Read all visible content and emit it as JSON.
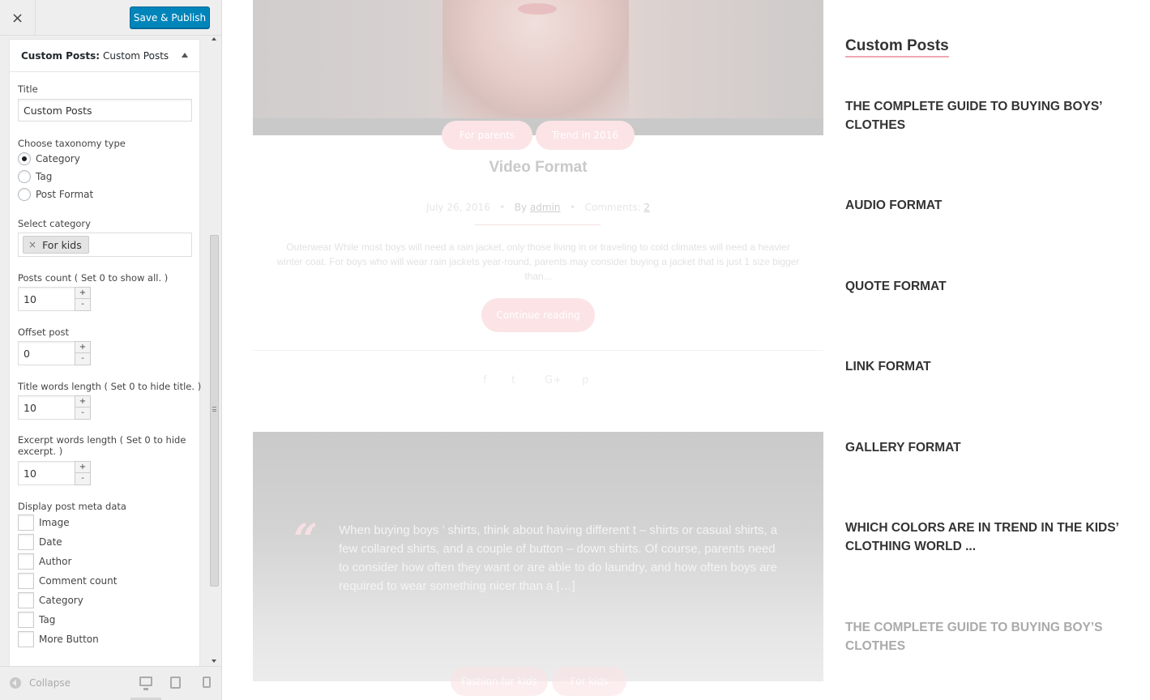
{
  "header": {
    "close_icon": "×",
    "publish_label": "Save & Publish"
  },
  "widget": {
    "title_prefix": "Custom Posts:",
    "title_name": "Custom Posts",
    "fields": {
      "title_label": "Title",
      "title_value": "Custom Posts",
      "taxonomy_label": "Choose taxonomy type",
      "taxonomy_options": [
        "Category",
        "Tag",
        "Post Format"
      ],
      "taxonomy_selected": "Category",
      "category_label": "Select category",
      "category_tag": "For kids",
      "category_tag_remove": "×",
      "posts_count_label": "Posts count ( Set 0 to show all. )",
      "posts_count_value": "10",
      "offset_label": "Offset post",
      "offset_value": "0",
      "title_words_label": "Title words length ( Set 0 to hide title. )",
      "title_words_value": "10",
      "excerpt_words_label": "Excerpt words length ( Set 0 to hide excerpt. )",
      "excerpt_words_value": "10",
      "spin_up": "+",
      "spin_down": "-",
      "meta_label": "Display post meta data",
      "meta_options": [
        "Image",
        "Date",
        "Author",
        "Comment count",
        "Category",
        "Tag",
        "More Button"
      ]
    }
  },
  "footer": {
    "collapse_label": "Collapse"
  },
  "preview": {
    "post": {
      "categories": [
        "For parents",
        "Trend in 2016"
      ],
      "title": "Video Format",
      "date": "July 26, 2016",
      "by": "By",
      "author": "admin",
      "comments_label": "Comments:",
      "comments_count": "2",
      "excerpt": "Outerwear While most boys will need a rain jacket, only those living in or traveling to cold climates will need a heavier winter coat. For boys who will wear rain jackets year-round, parents may consider buying a jacket that is just 1 size bigger than...",
      "continue_label": "Continue reading",
      "social_icons": [
        "facebook-icon",
        "twitter-icon",
        "google-plus-icon",
        "pinterest-icon"
      ]
    },
    "quote": {
      "mark": "“",
      "text": "When buying boys ’ shirts, think about having different t – shirts or casual shirts, a few collared shirts, and a couple of button – down shirts. Of course, parents need to consider how often they want or are able to do laundry, and how often boys are required to wear something nicer than a […]",
      "bottom_pills": [
        "Fashion for kids",
        "For kids"
      ]
    },
    "sidebar": {
      "widget_title": "Custom Posts",
      "items": [
        "The complete guide to buying boys’ clothes",
        "Audio Format",
        "Quote Format",
        "Link Format",
        "Gallery Format",
        "Which colors are in trend in the kids’ clothing world ...",
        "The complete guide to buying boy’s clothes"
      ]
    }
  },
  "colors": {
    "accent": "#0085ba",
    "pink": "#fbe3e6",
    "underline": "#f0a7b4"
  }
}
